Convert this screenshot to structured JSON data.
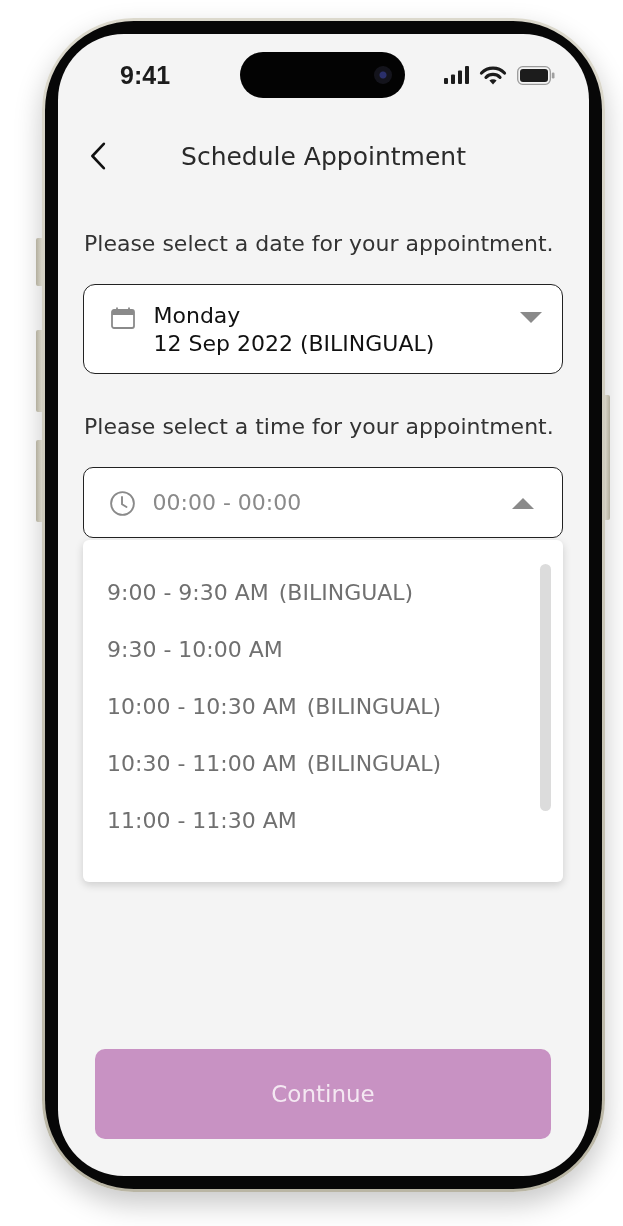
{
  "status_bar": {
    "time": "9:41"
  },
  "header": {
    "title": "Schedule Appointment"
  },
  "date_section": {
    "label": "Please select a date for your appointment.",
    "field": {
      "day": "Monday",
      "date": "12 Sep 2022 (BILINGUAL)",
      "expanded": false
    }
  },
  "time_section": {
    "label": "Please select a time for your appointment.",
    "field": {
      "placeholder": "00:00 - 00:00",
      "expanded": true
    },
    "options": [
      {
        "time": "9:00 - 9:30 AM",
        "tag": "(BILINGUAL)",
        "selected": false
      },
      {
        "time": "9:30 - 10:00 AM",
        "selected": false
      },
      {
        "time": "10:00 - 10:30 AM",
        "tag": "(BILINGUAL)",
        "selected": false
      },
      {
        "time": "10:30 - 11:00 AM",
        "tag": "(BILINGUAL)",
        "selected": false
      },
      {
        "time": "11:00 - 11:30 AM",
        "selected": false
      }
    ]
  },
  "continue_button": {
    "label": "Continue",
    "disabled": true
  }
}
